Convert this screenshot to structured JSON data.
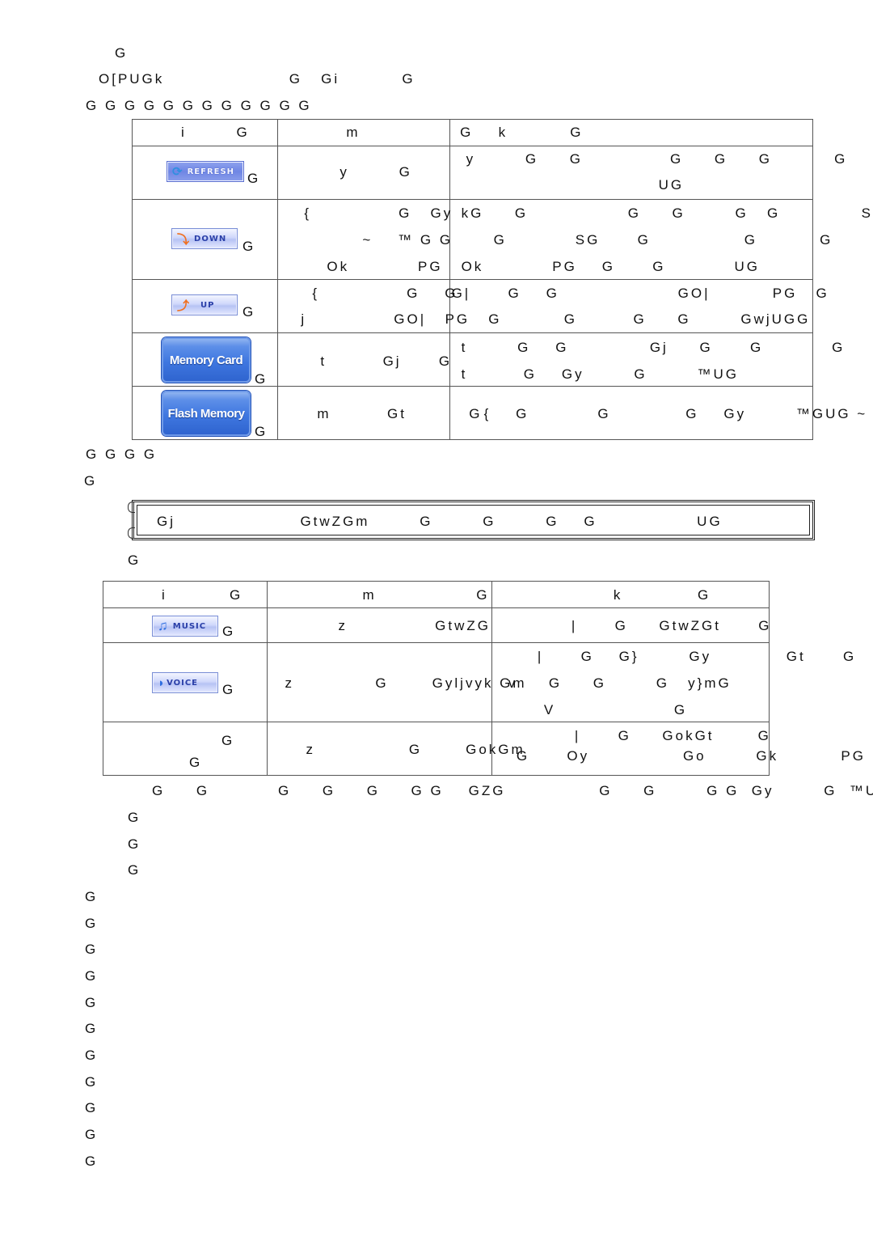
{
  "top_lines": [
    {
      "text": "G"
    },
    {
      "text": "O[PUGk                    G   Gi          G"
    },
    {
      "text": "G G G G G G G G G G G G"
    }
  ],
  "table1": {
    "headers": [
      "i        G",
      "m                G",
      "k          G"
    ],
    "rows": [
      {
        "button": "REFRESH",
        "button_icon": "refresh-arrows-icon",
        "suffix": "G",
        "name_lines": [
          "y        G"
        ],
        "desc_lines": [
          "y        G     G              G     G     G          G        G     G",
          "UG"
        ]
      },
      {
        "button": "DOWN",
        "button_icon": "down-arrow-icon",
        "suffix": "G",
        "name_lines": [
          "{              G   Gy",
          "~    ™ G G",
          "Ok           PG"
        ],
        "desc_lines": [
          "kG     G                G     G        G   G             SG    G",
          "G           SG      G               G          G        G     G",
          "Ok           PG    G      G           UG"
        ]
      },
      {
        "button": "UP",
        "button_icon": "up-arrow-icon",
        "suffix": "G",
        "name_lines": [
          "{              G    G",
          "j              GO|"
        ],
        "desc_lines": [
          "G|      G    G                   GO|          PG   G          G     G      G",
          "PG   G          G         G     G        GwjUGG"
        ]
      },
      {
        "button": "Memory Card",
        "suffix": "G",
        "name_lines": [
          "t         Gj      G"
        ],
        "desc_lines": [
          "t        G    G             Gj     G      G           G       G         GI",
          "t         G    Gy        G        ™UG"
        ]
      },
      {
        "button": "Flash Memory",
        "suffix": "G",
        "name_lines": [
          "m         Gt          G"
        ],
        "desc_lines": [
          "{    G           G            G    Gy        ™GUG ~"
        ]
      }
    ]
  },
  "after_table1": [
    "G G G G",
    "G"
  ],
  "note_box": {
    "text": "Gj                    GtwZGm        G        G        G    G                UG"
  },
  "after_note": "G",
  "table2": {
    "headers": [
      "i          G",
      "m                G",
      "k            G"
    ],
    "rows": [
      {
        "button": "MUSIC",
        "button_icon": "music-note-icon",
        "suffix": "G",
        "name_lines": [
          "z              GtwZG"
        ],
        "desc_lines": [
          "|      G     GtwZGt      G"
        ]
      },
      {
        "button": "VOICE",
        "button_icon": "speaking-head-icon",
        "suffix": "G",
        "name_lines": [
          "z             G       Gyljvyk Gm"
        ],
        "desc_lines": [
          "|      G    G}        Gy            Gt      G",
          "v     G     G        G   y}mG                        G",
          "V                   G"
        ]
      },
      {
        "button": "",
        "suffix_lines": [
          "G",
          "G"
        ],
        "name_lines": [
          "z               G       GokGm"
        ],
        "desc_lines": [
          "|      G     GokGt       G",
          "G      Oy               Go        Gk          PG"
        ]
      }
    ]
  },
  "after_table2_line": "G     G           G     G     G     G G    GZG               G     G        G G  Gy        G  ™UGG",
  "indented_lines": [
    "G",
    "G",
    "G"
  ],
  "left_lines": [
    "G",
    "G",
    "G",
    "G",
    "G",
    "G",
    "G",
    "G",
    "G",
    "G",
    "G"
  ],
  "colors": {
    "button_blue": "#3f77e0",
    "button_label": "#2a3fa8",
    "border": "#555555"
  }
}
